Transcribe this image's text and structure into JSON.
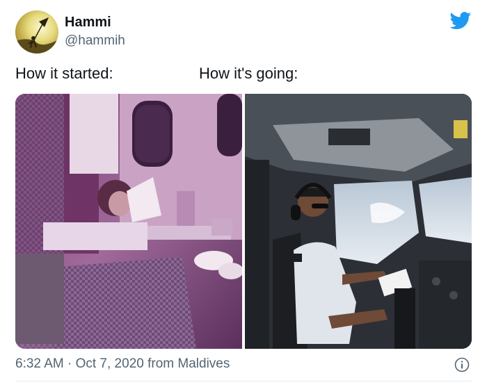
{
  "author": {
    "display_name": "Hammi",
    "handle": "@hammih",
    "avatar_icon": "kite-silhouette-avatar"
  },
  "brand": {
    "icon": "twitter-bird-icon",
    "color": "#1d9bf0"
  },
  "tweet": {
    "text_left": "How it started:",
    "text_right": "How it's going:"
  },
  "media": [
    {
      "name": "how-it-started-photo",
      "subject": "child-in-airplane-cabin-icon"
    },
    {
      "name": "how-its-going-photo",
      "subject": "pilot-in-cockpit-icon"
    }
  ],
  "footer": {
    "timestamp": "6:32 AM · Oct 7, 2020 from Maldives",
    "info_icon": "info-icon"
  }
}
